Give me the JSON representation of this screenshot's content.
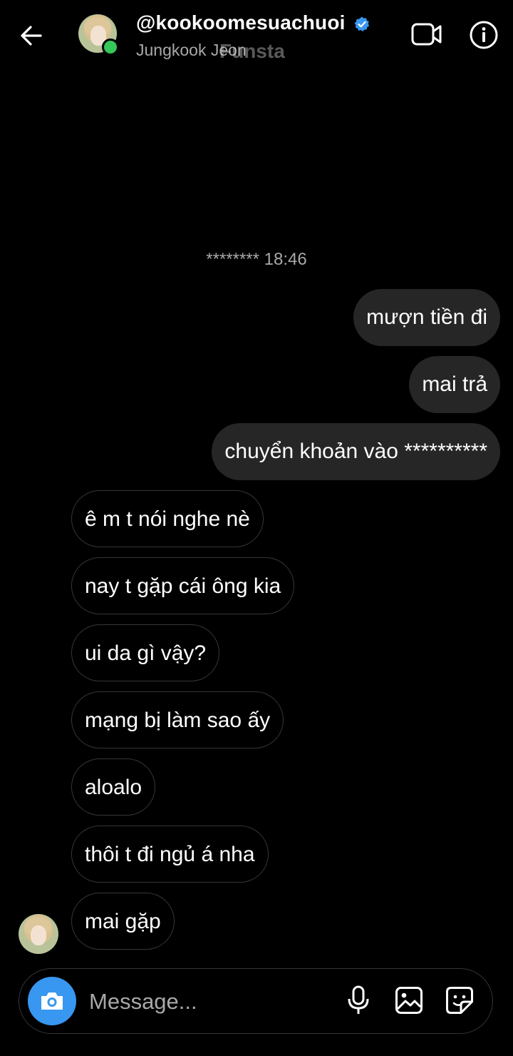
{
  "header": {
    "username": "@kookoomesuachuoi",
    "display_name": "Jungkook Jeon",
    "watermark": "Funsta",
    "icons": {
      "back": "back-arrow-icon",
      "verified": "verified-badge-icon",
      "video": "video-call-icon",
      "info": "info-icon"
    },
    "verified_color": "#3897f0",
    "online_color": "#35c759"
  },
  "chat": {
    "timestamp": "******** 18:46",
    "sent_messages": [
      {
        "text": "mượn tiền đi"
      },
      {
        "text": "mai trả"
      },
      {
        "text": "chuyển khoản vào **********"
      }
    ],
    "received_messages": [
      {
        "text": "ê m t nói nghe nè"
      },
      {
        "text": "nay t gặp cái ông kia"
      },
      {
        "text": "ui da gì vậy?"
      },
      {
        "text": "mạng bị làm sao ấy"
      },
      {
        "text": "aloalo"
      },
      {
        "text": "thôi t đi ngủ á nha"
      },
      {
        "text": "mai gặp"
      }
    ]
  },
  "composer": {
    "placeholder": "Message...",
    "value": "",
    "icons": {
      "camera": "camera-icon",
      "mic": "microphone-icon",
      "gallery": "gallery-icon",
      "sticker": "sticker-icon"
    },
    "camera_color": "#3897f0"
  }
}
